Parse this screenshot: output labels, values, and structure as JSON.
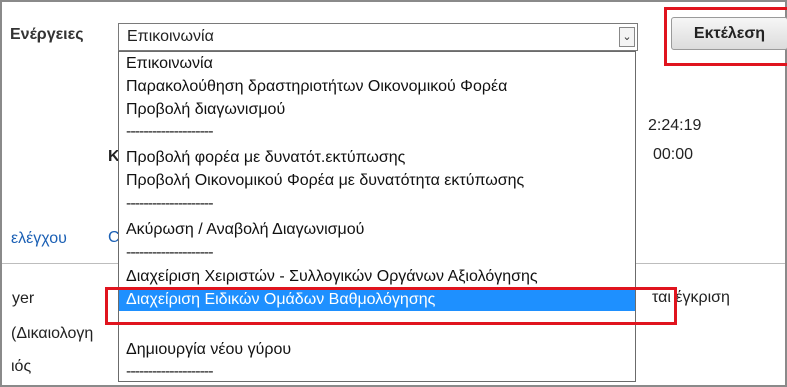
{
  "form": {
    "actions_label": "Ενέργειες",
    "select": {
      "value": "Επικοινωνία",
      "arrow_icon": "chevron-down-icon"
    },
    "run_button_label": "Εκτέλεση"
  },
  "dropdown": {
    "options": [
      {
        "label": "Επικοινωνία"
      },
      {
        "label": "Παρακολούθηση δραστηριοτήτων Οικονομικού Φορέα"
      },
      {
        "label": "Προβολή διαγωνισμού"
      },
      {
        "label": "--------------------"
      },
      {
        "label": "Προβολή φορέα με δυνατότ.εκτύπωσης"
      },
      {
        "label": "Προβολή Οικονομικού Φορέα με δυνατότητα εκτύπωσης"
      },
      {
        "label": "--------------------"
      },
      {
        "label": "Ακύρωση / Αναβολή Διαγωνισμού"
      },
      {
        "label": "--------------------"
      },
      {
        "label": "Διαχείριση Χειριστών - Συλλογικών Οργάνων Αξιολόγησης"
      },
      {
        "label": "Διαχείριση Ειδικών Ομάδων Βαθμολόγησης"
      },
      {
        "label": ""
      },
      {
        "label": "Δημιουργία νέου γύρου"
      },
      {
        "label": "--------------------"
      }
    ],
    "selected_index": 10
  },
  "background": {
    "time_1": "2:24:19",
    "time_2": "00:00",
    "letter_k": "Κ",
    "link_controls": "ελέγχου",
    "link_c": "C",
    "text_yer": "yer",
    "text_dikaiologi": "(Δικαιολογη",
    "text_ios": "ιός",
    "text_egkrisi": "ται έγκριση"
  },
  "colors": {
    "highlight": "#1e90ff",
    "annotation_red": "#e0141e",
    "link_blue": "#1a5fb4"
  }
}
